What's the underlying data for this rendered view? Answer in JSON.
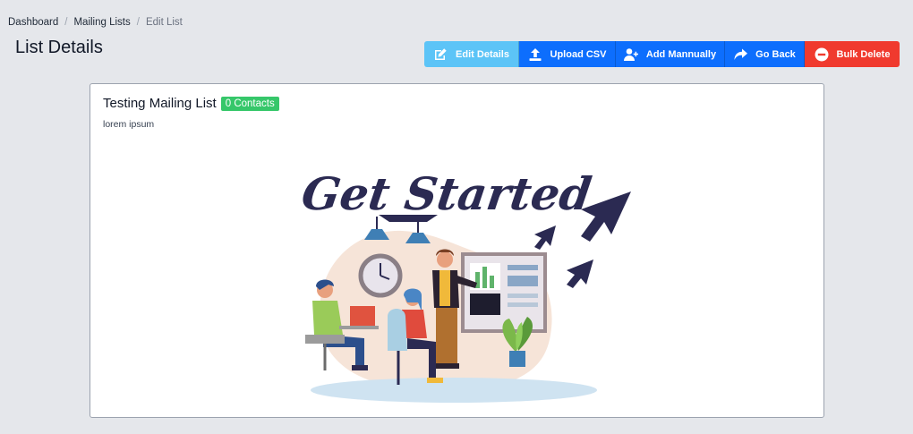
{
  "breadcrumb": {
    "items": [
      "Dashboard",
      "Mailing Lists"
    ],
    "current": "Edit List",
    "separator": "/"
  },
  "page": {
    "title": "List Details"
  },
  "toolbar": {
    "edit_label": "Edit Details",
    "upload_label": "Upload CSV",
    "add_label": "Add Mannually",
    "back_label": "Go Back",
    "bulk_label": "Bulk Delete"
  },
  "list": {
    "name": "Testing Mailing List",
    "badge": "0 Contacts",
    "description": "lorem ipsum",
    "illustration_text": "Get Started"
  },
  "colors": {
    "info": "#5cc4f7",
    "primary": "#0d6efd",
    "danger": "#f03a2e",
    "success": "#36c76a",
    "navy": "#2b2a52"
  }
}
